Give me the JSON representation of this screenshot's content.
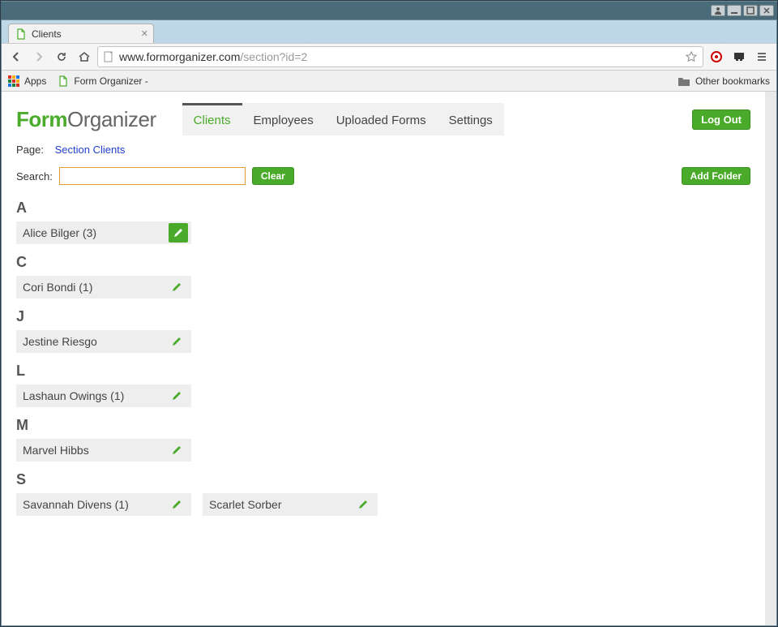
{
  "window": {
    "tab_title": "Clients",
    "url_host": "www.formorganizer.com",
    "url_path": "/section?id=2"
  },
  "bookmarks": {
    "apps": "Apps",
    "item1": "Form Organizer -",
    "other": "Other bookmarks"
  },
  "brand": {
    "first": "Form",
    "rest": "Organizer"
  },
  "nav": {
    "clients": "Clients",
    "employees": "Employees",
    "uploaded": "Uploaded Forms",
    "settings": "Settings",
    "logout": "Log Out"
  },
  "crumb": {
    "label": "Page:",
    "link": "Section Clients"
  },
  "search": {
    "label": "Search:",
    "value": "",
    "clear": "Clear"
  },
  "actions": {
    "add_folder": "Add Folder"
  },
  "groups": [
    {
      "letter": "A",
      "items": [
        {
          "name": "Alice Bilger (3)",
          "solid": true
        }
      ]
    },
    {
      "letter": "C",
      "items": [
        {
          "name": "Cori Bondi (1)"
        }
      ]
    },
    {
      "letter": "J",
      "items": [
        {
          "name": "Jestine Riesgo"
        }
      ]
    },
    {
      "letter": "L",
      "items": [
        {
          "name": "Lashaun Owings (1)"
        }
      ]
    },
    {
      "letter": "M",
      "items": [
        {
          "name": "Marvel Hibbs"
        }
      ]
    },
    {
      "letter": "S",
      "items": [
        {
          "name": "Savannah Divens (1)"
        },
        {
          "name": "Scarlet Sorber"
        }
      ]
    }
  ]
}
